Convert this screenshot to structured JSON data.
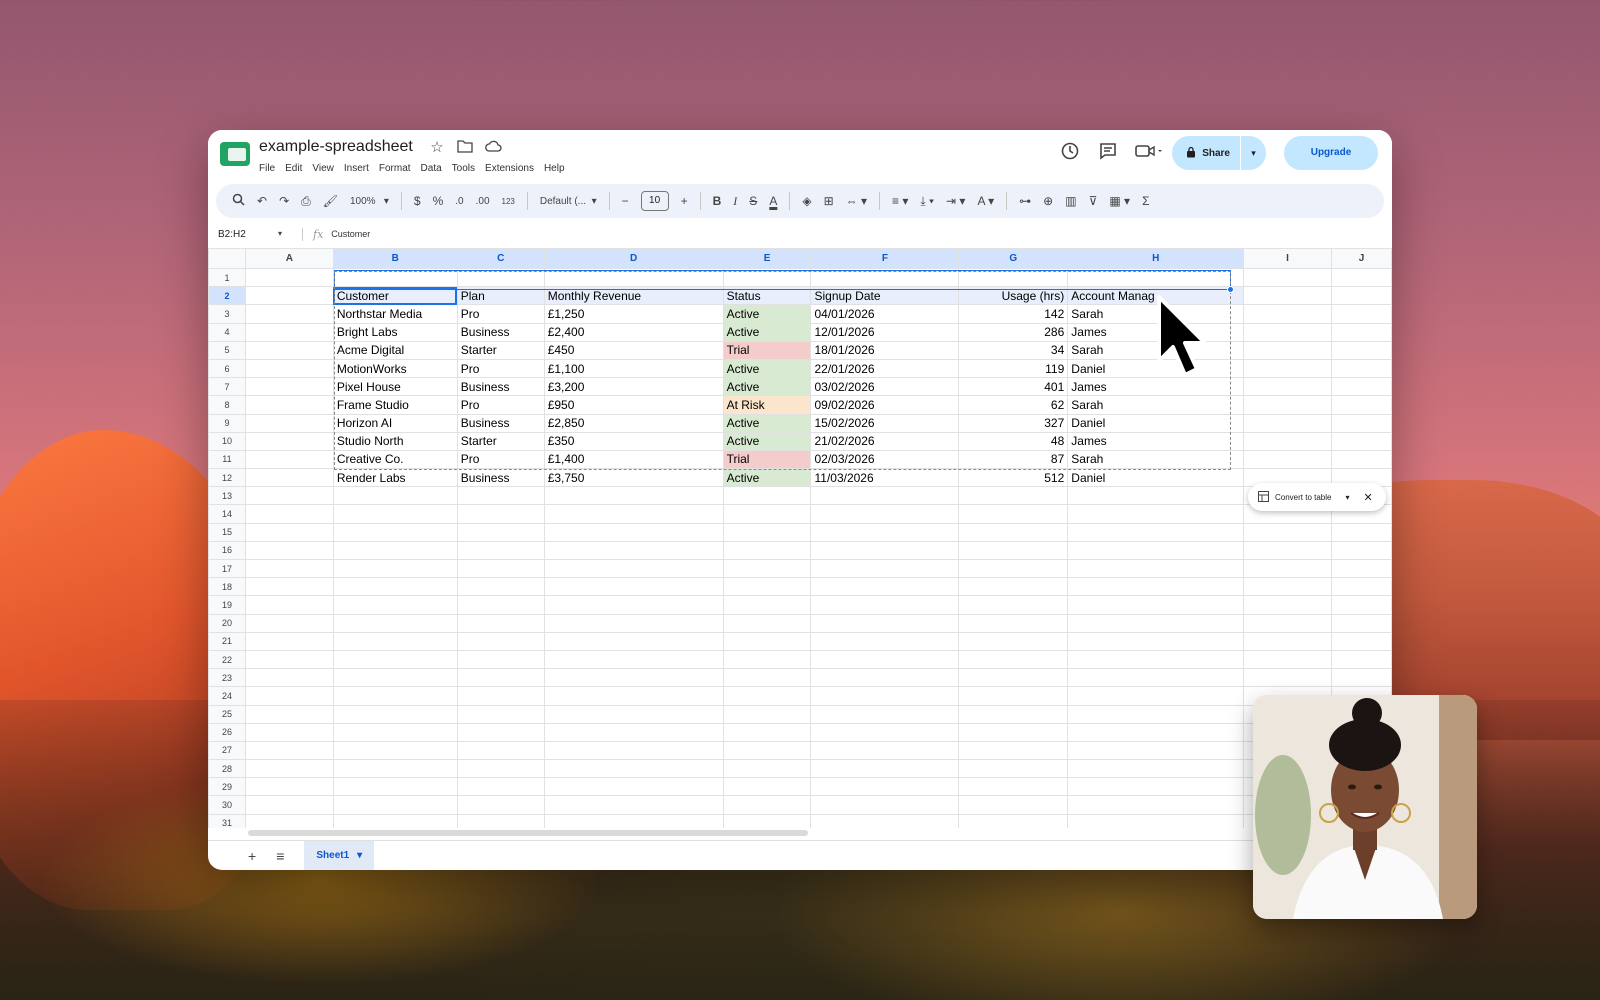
{
  "app": {
    "doc_title": "example-spreadsheet",
    "menu": [
      "File",
      "Edit",
      "View",
      "Insert",
      "Format",
      "Data",
      "Tools",
      "Extensions",
      "Help"
    ],
    "share_label": "Share",
    "upgrade_label": "Upgrade"
  },
  "toolbar": {
    "zoom": "100%",
    "currency": "$",
    "percent": "%",
    "decrease_decimals": ".0",
    "increase_decimals": ".00",
    "number_format": "123",
    "font": "Default (...",
    "font_size": "10"
  },
  "formula_bar": {
    "name_box": "B2:H2",
    "value": "Customer"
  },
  "grid": {
    "columns": [
      "A",
      "B",
      "C",
      "D",
      "E",
      "F",
      "G",
      "H",
      "I",
      "J"
    ],
    "selected_columns": [
      "B",
      "C",
      "D",
      "E",
      "F",
      "G",
      "H"
    ],
    "header": [
      "Customer",
      "Plan",
      "Monthly Revenue",
      "Status",
      "Signup Date",
      "Usage (hrs)",
      "Account Manag"
    ],
    "rows": [
      [
        "Northstar Media",
        "Pro",
        "£1,250",
        "Active",
        "04/01/2026",
        "142",
        "Sarah"
      ],
      [
        "Bright Labs",
        "Business",
        "£2,400",
        "Active",
        "12/01/2026",
        "286",
        "James"
      ],
      [
        "Acme Digital",
        "Starter",
        "£450",
        "Trial",
        "18/01/2026",
        "34",
        "Sarah"
      ],
      [
        "MotionWorks",
        "Pro",
        "£1,100",
        "Active",
        "22/01/2026",
        "119",
        "Daniel"
      ],
      [
        "Pixel House",
        "Business",
        "£3,200",
        "Active",
        "03/02/2026",
        "401",
        "James"
      ],
      [
        "Frame Studio",
        "Pro",
        "£950",
        "At Risk",
        "09/02/2026",
        "62",
        "Sarah"
      ],
      [
        "Horizon AI",
        "Business",
        "£2,850",
        "Active",
        "15/02/2026",
        "327",
        "Daniel"
      ],
      [
        "Studio North",
        "Starter",
        "£350",
        "Active",
        "21/02/2026",
        "48",
        "James"
      ],
      [
        "Creative Co.",
        "Pro",
        "£1,400",
        "Trial",
        "02/03/2026",
        "87",
        "Sarah"
      ],
      [
        "Render Labs",
        "Business",
        "£3,750",
        "Active",
        "11/03/2026",
        "512",
        "Daniel"
      ]
    ],
    "total_rows": 31
  },
  "chip": {
    "label": "Convert to table"
  },
  "sheet_tab": "Sheet1",
  "colors": {
    "active": "#d9ead3",
    "trial": "#f4cccc",
    "at_risk": "#fce5cd",
    "selection": "#1a73e8"
  }
}
